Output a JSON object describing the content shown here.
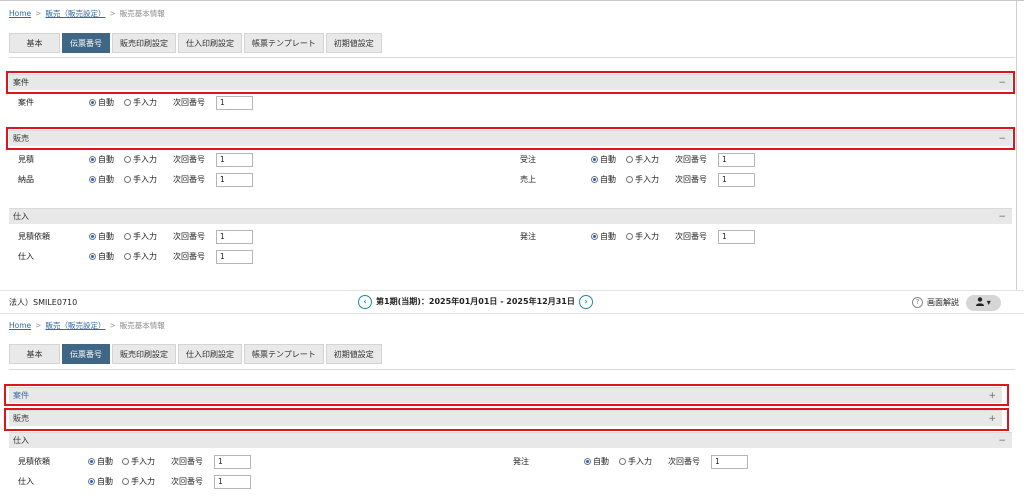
{
  "breadcrumb": {
    "home": "Home",
    "sep": ">",
    "parent": "販売（販売設定）",
    "current": "販売基本情報"
  },
  "tabs": [
    "基本",
    "伝票番号",
    "販売印刷設定",
    "仕入印刷設定",
    "帳票テンプレート",
    "初期値設定"
  ],
  "active_tab": "伝票番号",
  "radio": {
    "auto": "自動",
    "manual": "手入力"
  },
  "next_no_label": "次回番号",
  "top": {
    "section_anken": {
      "title": "案件",
      "toggle": "−",
      "rows": [
        {
          "label": "案件",
          "value": "1"
        }
      ]
    },
    "section_hanbai": {
      "title": "販売",
      "toggle": "−",
      "left": [
        {
          "label": "見積",
          "value": "1"
        },
        {
          "label": "納品",
          "value": "1"
        }
      ],
      "right": [
        {
          "label": "受注",
          "value": "1"
        },
        {
          "label": "売上",
          "value": "1"
        }
      ]
    },
    "section_shiire": {
      "title": "仕入",
      "toggle": "−",
      "left": [
        {
          "label": "見積依頼",
          "value": "1"
        },
        {
          "label": "仕入",
          "value": "1"
        }
      ],
      "right": [
        {
          "label": "発注",
          "value": "1"
        }
      ]
    }
  },
  "footer": {
    "company": "法人）SMILE0710",
    "period": "第1期(当期)：2025年01月01日 - 2025年12月31日",
    "prev_icon": "‹",
    "next_icon": "›",
    "help_icon": "?",
    "help_label": "画面解説",
    "user_menu": "▾"
  },
  "bottom": {
    "section_anken": {
      "title": "案件",
      "toggle": "+"
    },
    "section_hanbai": {
      "title": "販売",
      "toggle": "+"
    },
    "section_shiire": {
      "title": "仕入",
      "toggle": "−",
      "left": [
        {
          "label": "見積依頼",
          "value": "1"
        },
        {
          "label": "仕入",
          "value": "1"
        }
      ],
      "right": [
        {
          "label": "発注",
          "value": "1"
        }
      ]
    }
  },
  "colors": {
    "active_tab": "#3f6685",
    "highlight": "#e0141c",
    "accent": "#1e8ba5",
    "link": "#2c6aa8"
  }
}
